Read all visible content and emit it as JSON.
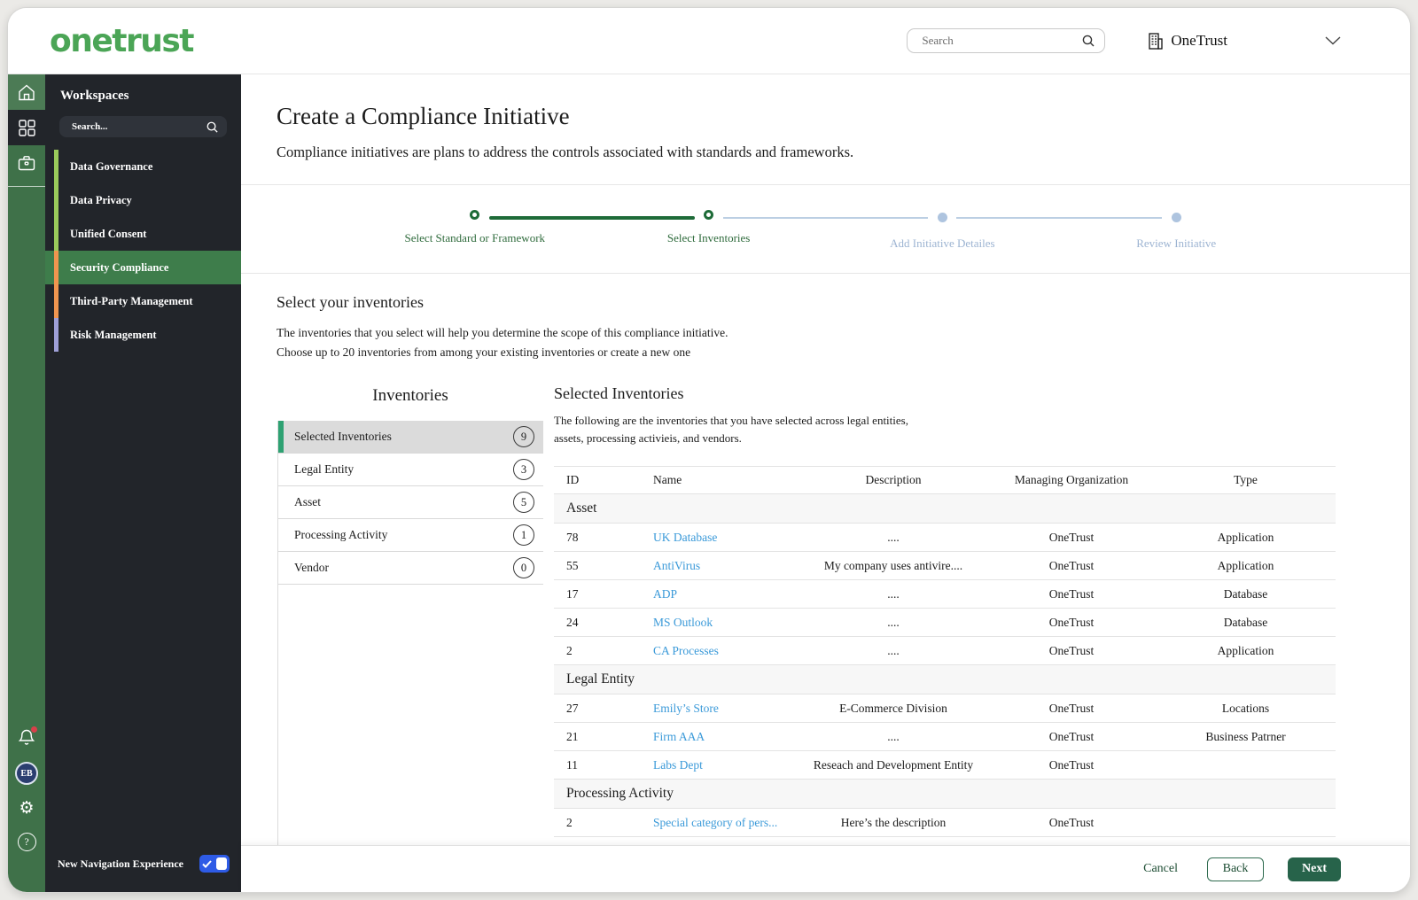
{
  "brand": {
    "logo": "onetrust",
    "logo_color": "#4BA556"
  },
  "header": {
    "search_placeholder": "Search",
    "org_name": "OneTrust"
  },
  "sidebar": {
    "title": "Workspaces",
    "search_placeholder": "Search...",
    "avatar_initials": "EB",
    "items": [
      {
        "label": "Data Governance",
        "accent": "#9BCB5B",
        "selected": false
      },
      {
        "label": "Data Privacy",
        "accent": "#9BCB5B",
        "selected": false
      },
      {
        "label": "Unified Consent",
        "accent": "#9BCB5B",
        "selected": false
      },
      {
        "label": "Security Compliance",
        "accent": "#F0954F",
        "selected": true
      },
      {
        "label": "Third-Party Management",
        "accent": "#F0954F",
        "selected": false
      },
      {
        "label": "Risk Management",
        "accent": "#9FA0D8",
        "selected": false
      }
    ],
    "footer": {
      "toggle_label": "New Navigation Experience",
      "toggle_on": true
    }
  },
  "page": {
    "title": "Create a Compliance Initiative",
    "subtitle": "Compliance initiatives are plans to address the controls associated with standards and frameworks."
  },
  "stepper": {
    "steps": [
      {
        "label": "Select Standard or Framework",
        "state": "complete"
      },
      {
        "label": "Select Inventories",
        "state": "current"
      },
      {
        "label": "Add Initiative Detailes",
        "state": "upcoming"
      },
      {
        "label": "Review Initiative",
        "state": "upcoming"
      }
    ]
  },
  "section": {
    "title": "Select your inventories",
    "description_line1": "The inventories that you select will help you determine the scope of this compliance initiative.",
    "description_line2": "Choose up to 20 inventories from among your existing inventories or create a new one"
  },
  "inventories_panel": {
    "title": "Inventories",
    "items": [
      {
        "label": "Selected Inventories",
        "count": "9",
        "selected": true
      },
      {
        "label": "Legal Entity",
        "count": "3",
        "selected": false
      },
      {
        "label": "Asset",
        "count": "5",
        "selected": false
      },
      {
        "label": "Processing Activity",
        "count": "1",
        "selected": false
      },
      {
        "label": "Vendor",
        "count": "0",
        "selected": false
      }
    ]
  },
  "selected_panel": {
    "title": "Selected Inventories",
    "description_line1": "The following are the inventories that you have selected across legal entities,",
    "description_line2": "assets, processing activieis, and vendors.",
    "columns": [
      "ID",
      "Name",
      "Description",
      "Managing Organization",
      "Type"
    ],
    "groups": [
      {
        "name": "Asset",
        "rows": [
          {
            "id": "78",
            "name": "UK Database",
            "description": "....",
            "org": "OneTrust",
            "type": "Application"
          },
          {
            "id": "55",
            "name": "AntiVirus",
            "description": "My company uses antivire....",
            "org": "OneTrust",
            "type": "Application"
          },
          {
            "id": "17",
            "name": "ADP",
            "description": "....",
            "org": "OneTrust",
            "type": "Database"
          },
          {
            "id": "24",
            "name": "MS Outlook",
            "description": "....",
            "org": "OneTrust",
            "type": "Database"
          },
          {
            "id": "2",
            "name": "CA Processes",
            "description": "....",
            "org": "OneTrust",
            "type": "Application"
          }
        ]
      },
      {
        "name": "Legal Entity",
        "rows": [
          {
            "id": "27",
            "name": "Emily’s Store",
            "description": "E-Commerce Division",
            "org": "OneTrust",
            "type": "Locations"
          },
          {
            "id": "21",
            "name": "Firm AAA",
            "description": "....",
            "org": "OneTrust",
            "type": "Business Patrner"
          },
          {
            "id": "11",
            "name": "Labs Dept",
            "description": "Reseach and Development Entity",
            "org": "OneTrust",
            "type": ""
          }
        ]
      },
      {
        "name": "Processing Activity",
        "rows": [
          {
            "id": "2",
            "name": "Special category of pers...",
            "description": "Here’s the description",
            "org": "OneTrust",
            "type": ""
          }
        ]
      }
    ]
  },
  "footer": {
    "cancel": "Cancel",
    "back": "Back",
    "next": "Next"
  },
  "icons": {
    "home": "house-outline",
    "workspaces": "grid-2x2",
    "apps": "briefcase",
    "notifications": "bell",
    "settings": "gear",
    "help": "question-circle",
    "search": "magnifier",
    "org": "building",
    "expand": "chevron-down",
    "toggle": "checkmark"
  },
  "colors": {
    "brand_green": "#4BA556",
    "rail_green": "#3F7149",
    "selected_green": "#3E7D4B",
    "link_blue": "#3B9AD9",
    "toggle_blue": "#2E5BE6",
    "stepper_green": "#1E6B38",
    "stepper_inactive": "#AEC4DF",
    "next_button_green": "#27634A",
    "selected_list_accent": "#2EA172"
  }
}
